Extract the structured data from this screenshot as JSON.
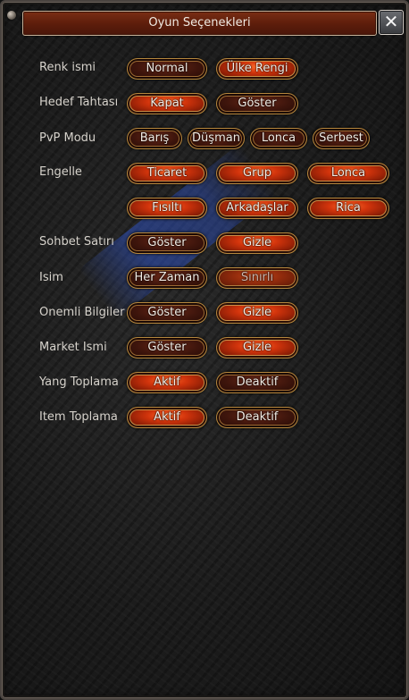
{
  "window": {
    "title": "Oyun Seçenekleri",
    "close_glyph": "✕"
  },
  "rows": {
    "renk_ismi": {
      "label": "Renk ismi",
      "buttons": [
        "Normal",
        "Ülke Rengi"
      ]
    },
    "hedef_tahtasi": {
      "label": "Hedef Tahtası",
      "buttons": [
        "Kapat",
        "Göster"
      ]
    },
    "pvp_modu": {
      "label": "PvP Modu",
      "buttons": [
        "Barış",
        "Düşman",
        "Lonca",
        "Serbest"
      ]
    },
    "engelle": {
      "label": "Engelle",
      "buttons": [
        "Ticaret",
        "Grup",
        "Lonca",
        "Fısıltı",
        "Arkadaşlar",
        "Rica"
      ]
    },
    "sohbet_satiri": {
      "label": "Sohbet Satırı",
      "buttons": [
        "Göster",
        "Gizle"
      ]
    },
    "isim": {
      "label": "Isim",
      "buttons": [
        "Her Zaman",
        "Sınırlı"
      ]
    },
    "onemli_bilgiler": {
      "label": "Önemli Bilgiler",
      "buttons": [
        "Göster",
        "Gizle"
      ]
    },
    "market_ismi": {
      "label": "Market İsmi",
      "buttons": [
        "Göster",
        "Gizle"
      ]
    },
    "yang_toplama": {
      "label": "Yang Toplama",
      "buttons": [
        "Aktif",
        "Deaktif"
      ]
    },
    "item_toplama": {
      "label": "İtem Toplama",
      "buttons": [
        "Aktif",
        "Deaktif"
      ]
    }
  },
  "colors": {
    "title_bar": "#6a230e",
    "button_active": "#d2340c",
    "button_inactive": "#3e150c",
    "button_border": "#b4873d",
    "watermark": "#2d50be"
  },
  "icons": {
    "rivet": "rivet-icon",
    "close": "close-icon"
  }
}
